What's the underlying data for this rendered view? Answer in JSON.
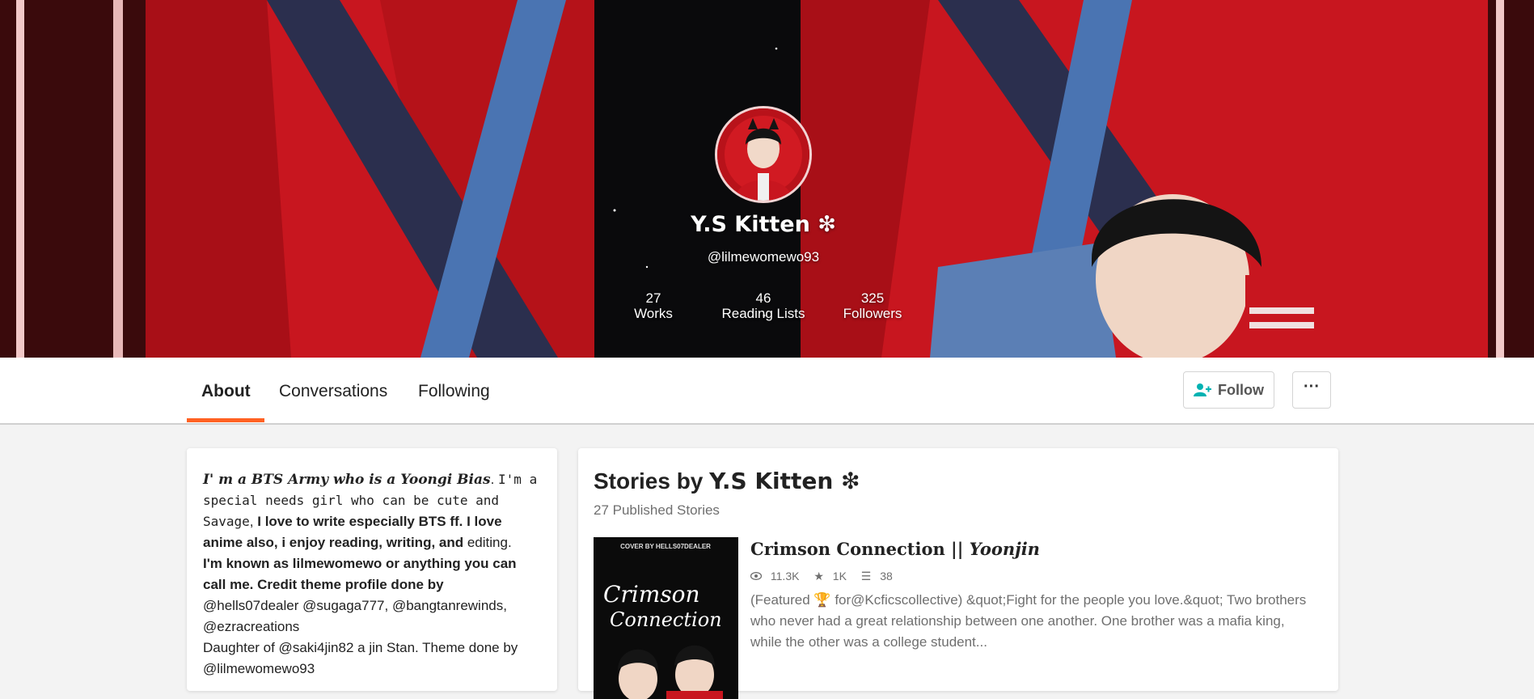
{
  "profile": {
    "display_name": "Y.S Kitten ❇",
    "username": "@lilmewomewo93",
    "stats": [
      {
        "value": "27",
        "label": "Works"
      },
      {
        "value": "46",
        "label": "Reading Lists"
      },
      {
        "value": "325",
        "label": "Followers"
      }
    ]
  },
  "nav": {
    "tabs": [
      {
        "label": "About",
        "active": true
      },
      {
        "label": "Conversations",
        "active": false
      },
      {
        "label": "Following",
        "active": false
      }
    ],
    "follow_label": "Follow",
    "more_label": "···"
  },
  "about": {
    "segments": [
      "I' m a BTS Army who is a Yoongi Bias",
      ". ",
      "I'm a special needs girl who can be cute and Savage",
      ", ",
      "I love to write especially BTS ff. I love anime also, i enjoy reading, writing, and",
      " editing.",
      "I'm known as lilmewomewo or anything you can call me.  Credit theme profile done by",
      "@hells07dealer  @sugaga777, @bangtanrewinds, @ezracreations",
      "Daughter of @saki4jin82 a jin Stan.  Theme done by @lilmewomewo93"
    ]
  },
  "stories": {
    "title_prefix": "Stories by ",
    "title_name": "Y.S Kitten ❇",
    "count_text": "27 Published Stories",
    "items": [
      {
        "title_main": "Crimson Connection || ",
        "title_italic": "Yoonjin",
        "reads": "11.3K",
        "votes": "1K",
        "parts": "38",
        "description": "(Featured 🏆 for@Kcficscollective) &quot;Fight for the people you love.&quot; Two brothers who never had a great relationship between one another. One brother was a mafia king, while the other was a college student...",
        "cover_credit": "COVER BY HELLS07DEALER",
        "cover_title_1": "Crimson",
        "cover_title_2": "Connection"
      }
    ]
  },
  "colors": {
    "accent": "#ff6122",
    "follow_icon": "#00b2b2",
    "banner_red": "#c8161f"
  }
}
